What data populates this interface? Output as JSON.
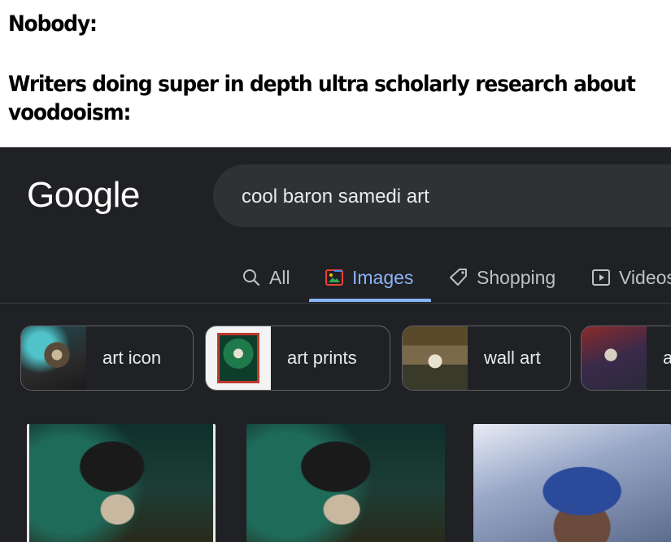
{
  "caption": {
    "line1": "Nobody:",
    "line2": "Writers doing super in depth ultra scholarly research about",
    "line3": "voodooism:"
  },
  "google": {
    "logo": "Google",
    "search_query": "cool baron samedi art",
    "tabs": [
      {
        "label": "All",
        "icon": "search-icon",
        "active": false
      },
      {
        "label": "Images",
        "icon": "images-icon",
        "active": true
      },
      {
        "label": "Shopping",
        "icon": "tag-icon",
        "active": false
      },
      {
        "label": "Videos",
        "icon": "play-icon",
        "active": false
      }
    ],
    "chips": [
      {
        "label": "art icon"
      },
      {
        "label": "art prints"
      },
      {
        "label": "wall art"
      },
      {
        "label": "a"
      }
    ],
    "colors": {
      "background": "#202124",
      "search_box": "#303134",
      "active_tab": "#8ab4f8",
      "text": "#e8eaed",
      "muted_text": "#bdc1c6"
    }
  }
}
